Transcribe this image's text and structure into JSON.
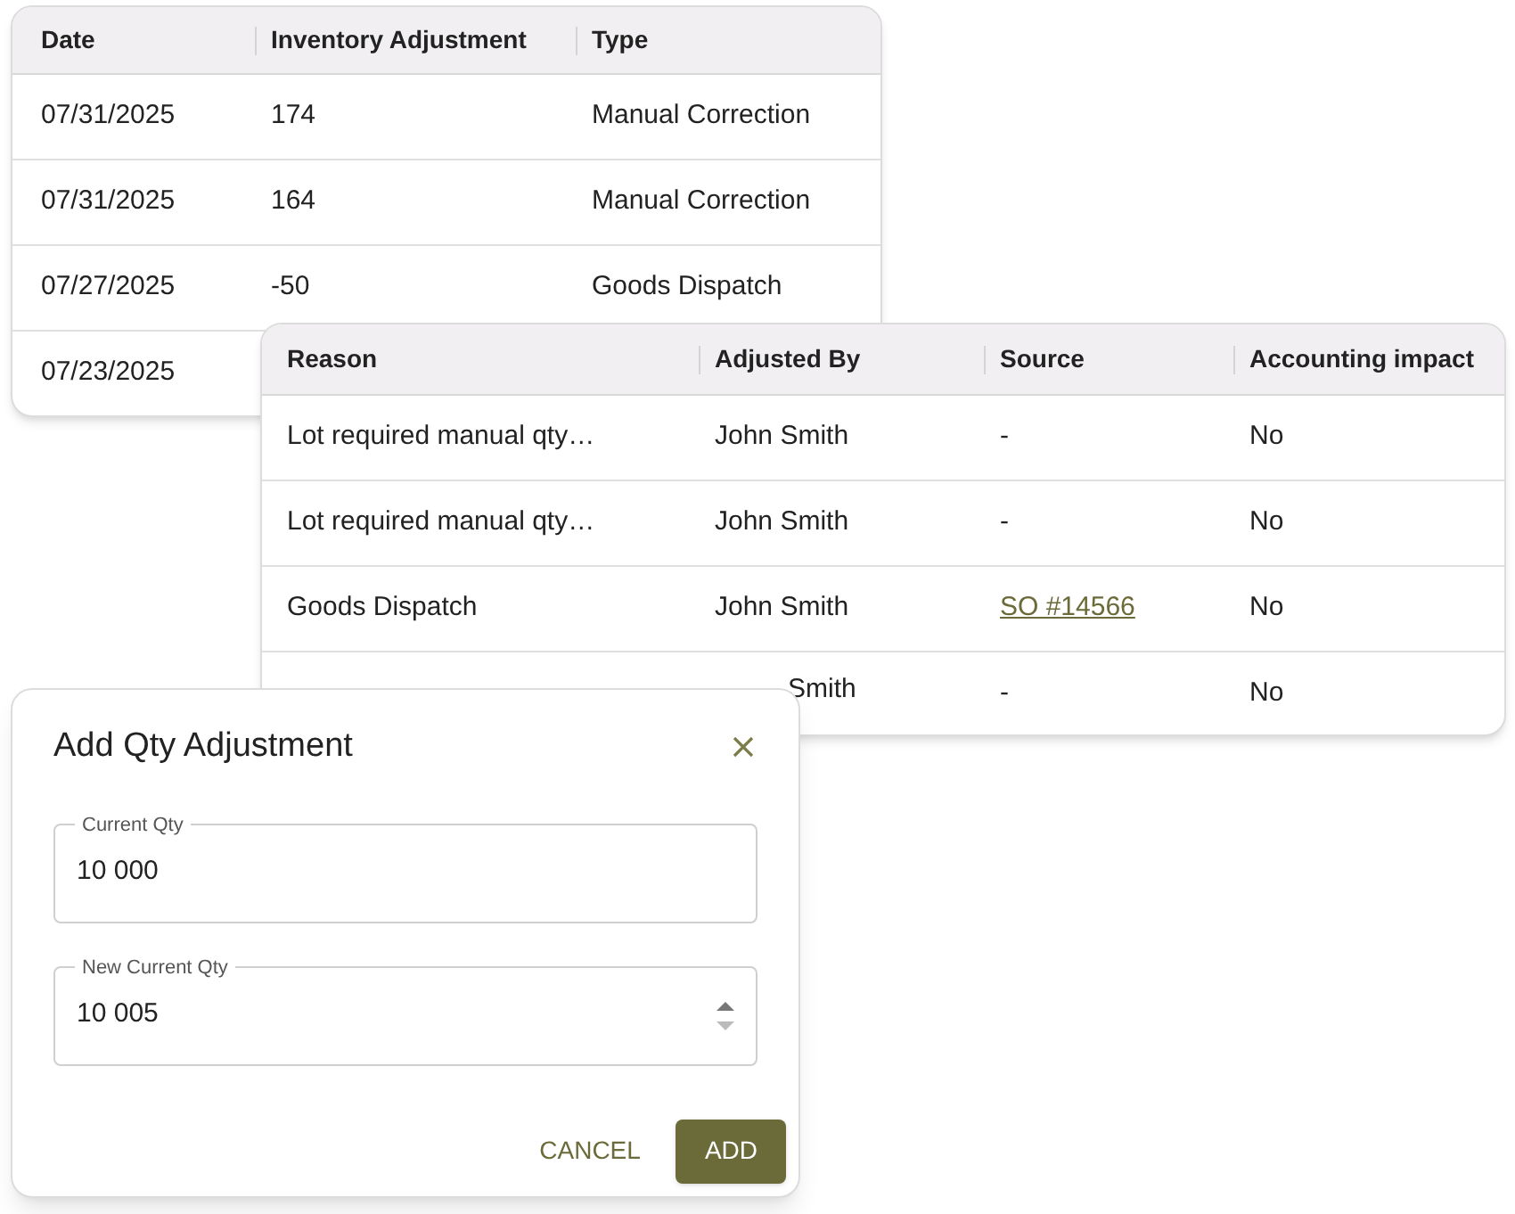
{
  "inventory_table": {
    "columns": [
      "Date",
      "Inventory Adjustment",
      "Type"
    ],
    "rows": [
      {
        "date": "07/31/2025",
        "adjustment": "174",
        "type": "Manual Correction"
      },
      {
        "date": "07/31/2025",
        "adjustment": "164",
        "type": "Manual Correction"
      },
      {
        "date": "07/27/2025",
        "adjustment": "-50",
        "type": "Goods Dispatch"
      },
      {
        "date": "07/23/2025"
      }
    ]
  },
  "details_table": {
    "columns": [
      "Reason",
      "Adjusted By",
      "Source",
      "Accounting impact"
    ],
    "rows": [
      {
        "reason": "Lot required manual qty…",
        "adjusted_by": "John Smith",
        "source": {
          "text": "-",
          "kind": "plain"
        },
        "accounting_impact": "No"
      },
      {
        "reason": "Lot required manual qty…",
        "adjusted_by": "John Smith",
        "source": {
          "text": "-",
          "kind": "plain"
        },
        "accounting_impact": "No"
      },
      {
        "reason": "Goods Dispatch",
        "adjusted_by": "John Smith",
        "source": {
          "text": "SO #14566",
          "kind": "link"
        },
        "accounting_impact": "No"
      },
      {
        "adjusted_by": "Smith",
        "source": {
          "text": "-",
          "kind": "plain"
        },
        "accounting_impact": "No"
      }
    ]
  },
  "dialog": {
    "title": "Add Qty Adjustment",
    "fields": [
      {
        "label": "Current Qty",
        "value": "10 000",
        "kind": "text"
      },
      {
        "label": "New Current Qty",
        "value": "10 005",
        "kind": "number"
      }
    ],
    "buttons": [
      {
        "label": "CANCEL",
        "kind": "text"
      },
      {
        "label": "ADD",
        "kind": "filled"
      }
    ]
  }
}
